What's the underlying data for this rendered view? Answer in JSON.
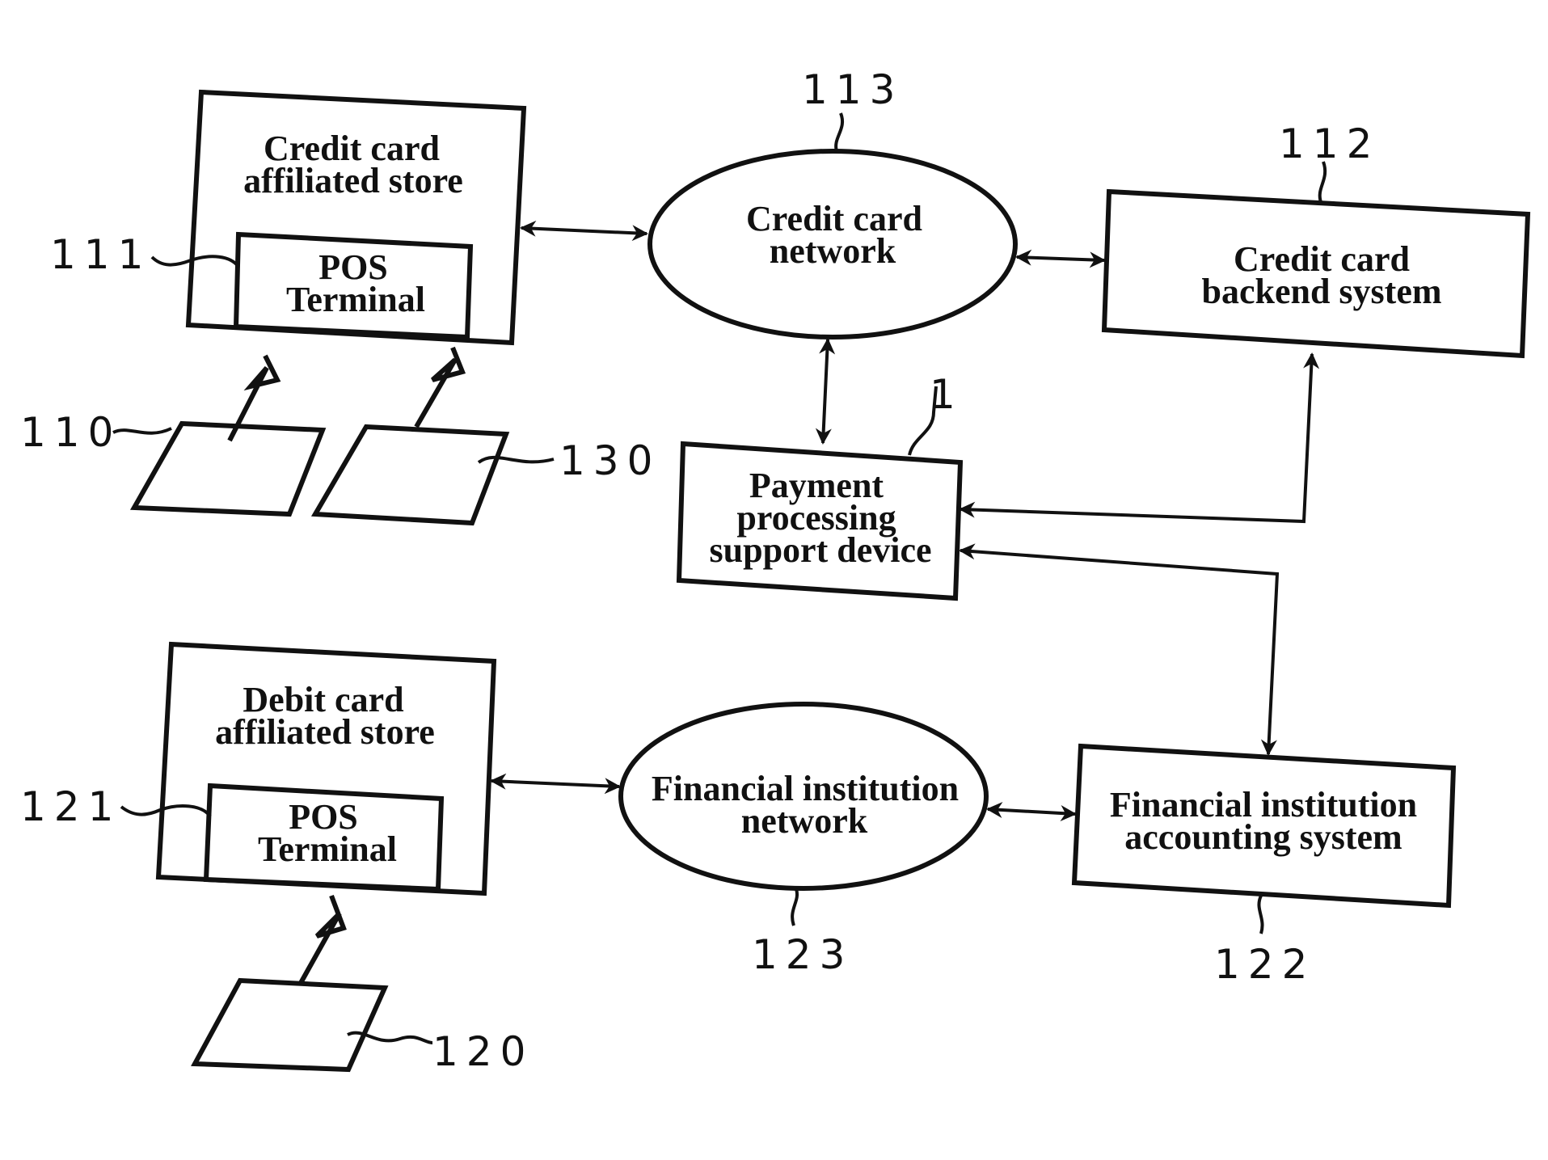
{
  "diagram": {
    "type": "block-diagram",
    "nodes": {
      "credit_store": {
        "ref": "111",
        "lines": [
          "Credit card",
          "affiliated store"
        ],
        "pos_lines": [
          "POS",
          "Terminal"
        ]
      },
      "credit_network": {
        "ref": "113",
        "lines": [
          "Credit card",
          "network"
        ]
      },
      "credit_backend": {
        "ref": "112",
        "lines": [
          "Credit card",
          "backend system"
        ]
      },
      "payment_device": {
        "ref": "1",
        "lines": [
          "Payment",
          "processing",
          "support device"
        ]
      },
      "debit_store": {
        "ref": "121",
        "lines": [
          "Debit card",
          "affiliated store"
        ],
        "pos_lines": [
          "POS",
          "Terminal"
        ]
      },
      "fi_network": {
        "ref": "123",
        "lines": [
          "Financial institution",
          "network"
        ]
      },
      "fi_accounting": {
        "ref": "122",
        "lines": [
          "Financial institution",
          "accounting system"
        ]
      },
      "card_110": {
        "ref": "110"
      },
      "card_130": {
        "ref": "130"
      },
      "card_120": {
        "ref": "120"
      }
    },
    "edges": [
      {
        "from": "credit_store",
        "to": "credit_network",
        "kind": "bidirectional"
      },
      {
        "from": "credit_network",
        "to": "credit_backend",
        "kind": "bidirectional"
      },
      {
        "from": "credit_network",
        "to": "payment_device",
        "kind": "bidirectional"
      },
      {
        "from": "credit_backend",
        "to": "payment_device",
        "kind": "bidirectional"
      },
      {
        "from": "payment_device",
        "to": "fi_accounting",
        "kind": "bidirectional"
      },
      {
        "from": "debit_store",
        "to": "fi_network",
        "kind": "bidirectional"
      },
      {
        "from": "fi_network",
        "to": "fi_accounting",
        "kind": "bidirectional"
      },
      {
        "from": "card_110",
        "to": "credit_store",
        "kind": "wireless"
      },
      {
        "from": "card_130",
        "to": "credit_store",
        "kind": "wireless"
      },
      {
        "from": "card_120",
        "to": "debit_store",
        "kind": "wireless"
      }
    ]
  }
}
